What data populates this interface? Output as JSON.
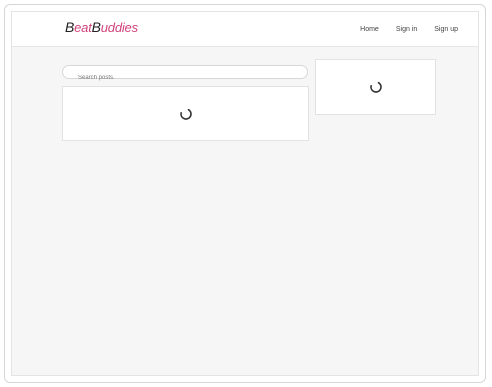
{
  "brand": {
    "first_initial": "B",
    "first_rest": "eat",
    "second_initial": "B",
    "second_rest": "uddies",
    "accent_color": "#d1437a"
  },
  "nav": {
    "items": [
      {
        "label": "Home"
      },
      {
        "label": "Sign in"
      },
      {
        "label": "Sign up"
      }
    ]
  },
  "search": {
    "placeholder": "Search posts.",
    "value": ""
  },
  "posts_panel": {
    "state": "loading",
    "icon": "spinner-icon"
  },
  "side_panel": {
    "state": "loading",
    "icon": "spinner-icon"
  }
}
